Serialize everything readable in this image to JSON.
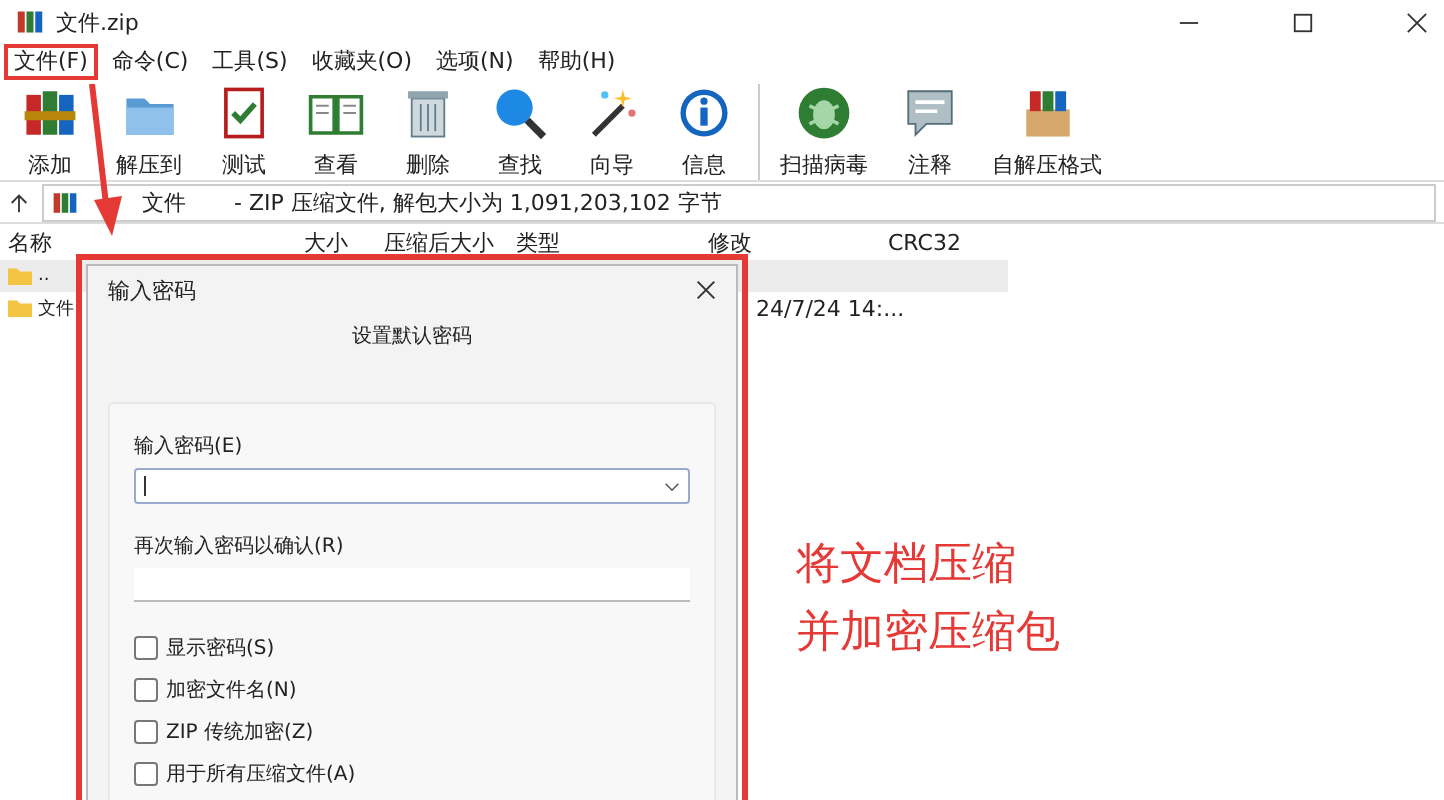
{
  "window": {
    "title": "文件.zip"
  },
  "menu": [
    {
      "label": "文件(F)",
      "highlighted": true
    },
    {
      "label": "命令(C)",
      "highlighted": false
    },
    {
      "label": "工具(S)",
      "highlighted": false
    },
    {
      "label": "收藏夹(O)",
      "highlighted": false
    },
    {
      "label": "选项(N)",
      "highlighted": false
    },
    {
      "label": "帮助(H)",
      "highlighted": false
    }
  ],
  "toolbar": [
    {
      "label": "添加"
    },
    {
      "label": "解压到"
    },
    {
      "label": "测试"
    },
    {
      "label": "查看"
    },
    {
      "label": "删除"
    },
    {
      "label": "查找"
    },
    {
      "label": "向导"
    },
    {
      "label": "信息"
    },
    {
      "label": "扫描病毒"
    },
    {
      "label": "注释"
    },
    {
      "label": "自解压格式"
    }
  ],
  "path_bar": {
    "name": "文件",
    "description": "- ZIP 压缩文件, 解包大小为 1,091,203,102 字节"
  },
  "table": {
    "columns": [
      "名称",
      "大小",
      "压缩后大小",
      "类型",
      "修改",
      "CRC32"
    ],
    "rows": [
      {
        "name": "..",
        "modified": "",
        "selected": true
      },
      {
        "name": "文件",
        "modified": "24/7/24 14:...",
        "selected": false
      }
    ]
  },
  "dialog": {
    "title": "输入密码",
    "subtitle": "设置默认密码",
    "highlighted": true,
    "password_label": "输入密码(E)",
    "confirm_label": "再次输入密码以确认(R)",
    "options": [
      {
        "label": "显示密码(S)",
        "checked": false
      },
      {
        "label": "加密文件名(N)",
        "checked": false
      },
      {
        "label": "ZIP 传统加密(Z)",
        "checked": false
      },
      {
        "label": "用于所有压缩文件(A)",
        "checked": false
      }
    ]
  },
  "annotation": {
    "lines": [
      "将文档压缩",
      "并加密压缩包"
    ]
  }
}
